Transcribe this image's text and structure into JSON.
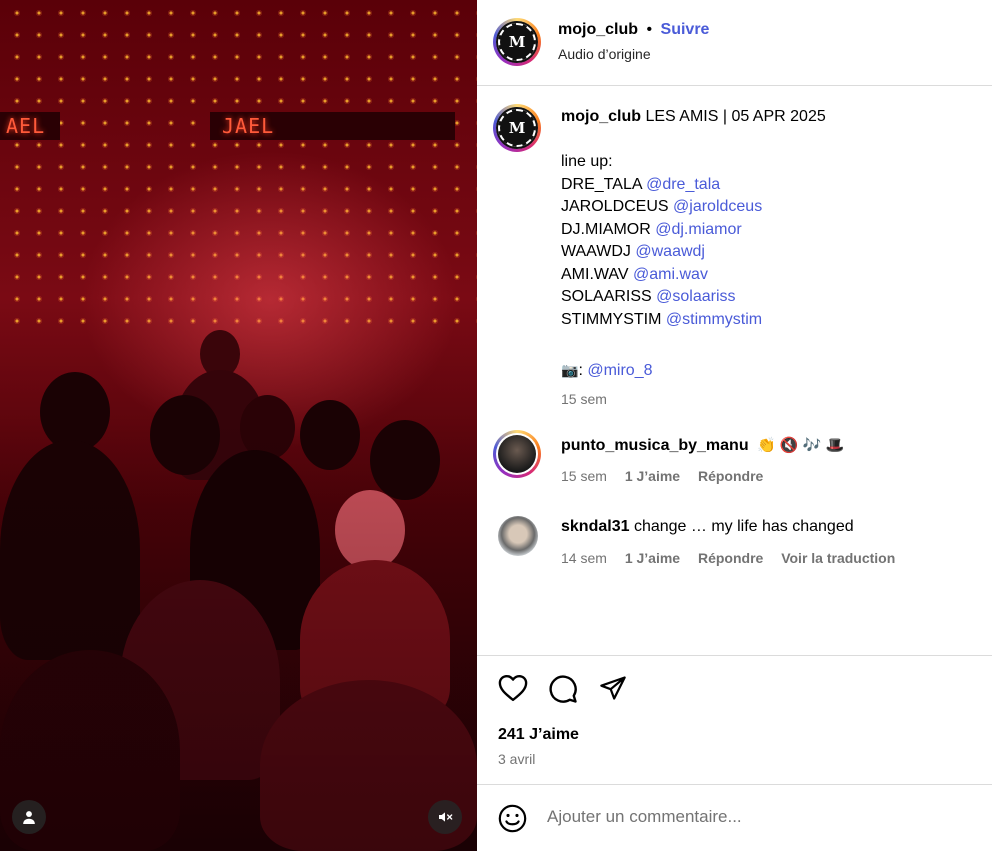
{
  "post": {
    "author": "mojo_club",
    "follow_label": "Suivre",
    "separator": "•",
    "audio": "Audio d’origine"
  },
  "caption": {
    "author": "mojo_club",
    "title": "LES AMIS | 05 APR 2025",
    "lineup_label": "line up:",
    "artists": [
      {
        "name": "DRE_TALA",
        "handle": "@dre_tala"
      },
      {
        "name": "JAROLDCEUS",
        "handle": "@jaroldceus"
      },
      {
        "name": "DJ.MIAMOR",
        "handle": "@dj.miamor"
      },
      {
        "name": "WAAWDJ",
        "handle": "@waawdj"
      },
      {
        "name": "AMI.WAV",
        "handle": "@ami.wav"
      },
      {
        "name": "SOLAARISS",
        "handle": "@solaariss"
      },
      {
        "name": "STIMMYSTIM",
        "handle": "@stimmystim"
      }
    ],
    "photo_credit_icon": "📷",
    "photo_credit_sep": ":",
    "photo_credit": "@miro_8",
    "time": "15 sem"
  },
  "comments": [
    {
      "author": "punto_musica_by_manu",
      "text": "👏 🔇 🎶 🎩",
      "time": "15 sem",
      "likes": "1 J’aime",
      "reply": "Répondre",
      "translate": ""
    },
    {
      "author": "skndal31",
      "text": "change … my life has changed",
      "time": "14 sem",
      "likes": "1 J’aime",
      "reply": "Répondre",
      "translate": "Voir la traduction"
    }
  ],
  "media": {
    "sign_text": "JAEL",
    "sign_text_left": "AEL"
  },
  "stats": {
    "likes": "241 J’aime",
    "date": "3 avril"
  },
  "comment_box": {
    "placeholder": "Ajouter un commentaire..."
  },
  "icons": {
    "like": "heart-icon",
    "comment": "comment-bubble-icon",
    "share": "paper-plane-icon",
    "emoji": "emoji-icon",
    "user_tags": "user-icon",
    "mute": "speaker-muted-icon"
  },
  "colors": {
    "link": "#4a5bd8",
    "muted": "#737373",
    "border": "#dbdbdb"
  }
}
